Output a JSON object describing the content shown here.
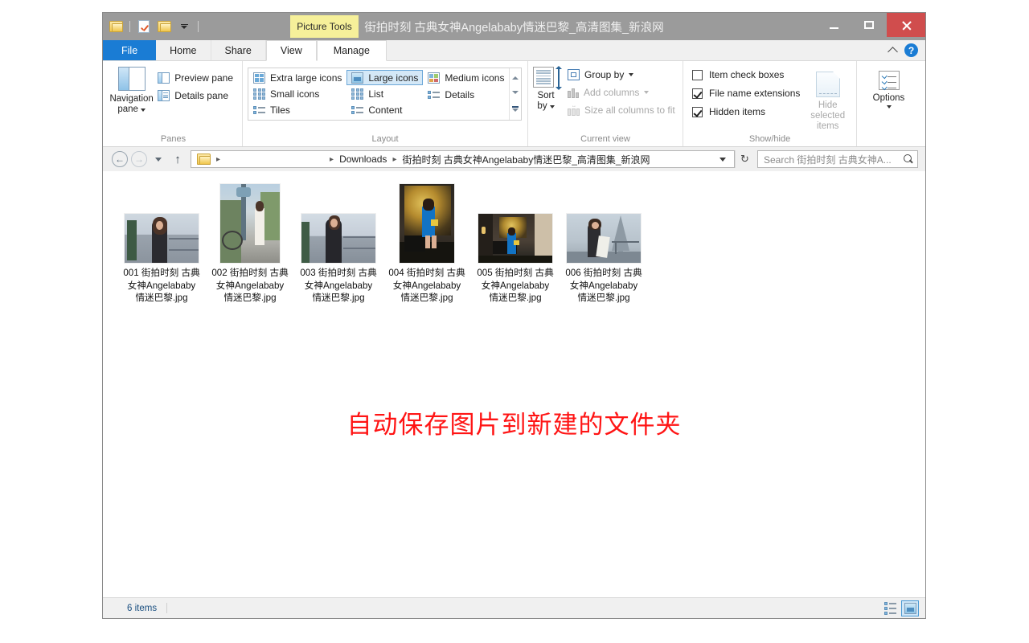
{
  "window": {
    "title": "街拍时刻 古典女神Angelababy情迷巴黎_高清图集_新浪网",
    "contextual_tab_group": "Picture Tools",
    "minimize_label": "Minimize",
    "maximize_label": "Maximize",
    "close_label": "Close"
  },
  "quick_access": {
    "folder_icon": "folder-icon",
    "properties_icon": "properties-icon",
    "new_folder_icon": "new-folder-icon",
    "customize_icon": "customize-quick-access-icon"
  },
  "tabs": [
    {
      "label": "File",
      "state": "file"
    },
    {
      "label": "Home",
      "state": "normal"
    },
    {
      "label": "Share",
      "state": "normal"
    },
    {
      "label": "View",
      "state": "active"
    },
    {
      "label": "Manage",
      "state": "contextual"
    }
  ],
  "ribbon_right": {
    "collapse_icon": "chevron-up-icon",
    "help_icon": "help-icon",
    "help_glyph": "?"
  },
  "ribbon": {
    "groups": [
      {
        "label": "Panes",
        "big_button": {
          "line1": "Navigation",
          "line2": "pane",
          "icon": "navigation-pane-icon"
        },
        "items": [
          {
            "label": "Preview pane",
            "icon": "preview-pane-icon",
            "disabled": false
          },
          {
            "label": "Details pane",
            "icon": "details-pane-icon",
            "disabled": false
          }
        ]
      },
      {
        "label": "Layout",
        "gallery": [
          {
            "label": "Extra large icons",
            "icon": "extra-large-icons-icon",
            "selected": false
          },
          {
            "label": "Small icons",
            "icon": "small-icons-icon",
            "selected": false
          },
          {
            "label": "Tiles",
            "icon": "tiles-icon",
            "selected": false
          },
          {
            "label": "Large icons",
            "icon": "large-icons-icon",
            "selected": true
          },
          {
            "label": "List",
            "icon": "list-icon",
            "selected": false
          },
          {
            "label": "Content",
            "icon": "content-icon",
            "selected": false
          },
          {
            "label": "Medium icons",
            "icon": "medium-icons-icon",
            "selected": false
          },
          {
            "label": "Details",
            "icon": "details-icon",
            "selected": false
          }
        ]
      },
      {
        "label": "Current view",
        "big_button": {
          "line1": "Sort",
          "line2": "by",
          "icon": "sort-by-icon"
        },
        "items": [
          {
            "label": "Group by",
            "icon": "group-by-icon",
            "disabled": false,
            "dropdown": true
          },
          {
            "label": "Add columns",
            "icon": "add-columns-icon",
            "disabled": true,
            "dropdown": true
          },
          {
            "label": "Size all columns to fit",
            "icon": "size-columns-icon",
            "disabled": true,
            "dropdown": false
          }
        ]
      },
      {
        "label": "Show/hide",
        "checkboxes": [
          {
            "label": "Item check boxes",
            "checked": false
          },
          {
            "label": "File name extensions",
            "checked": true
          },
          {
            "label": "Hidden items",
            "checked": true
          }
        ],
        "hide_selected": {
          "line1": "Hide selected",
          "line2": "items",
          "icon": "hide-selected-items-icon",
          "disabled": true
        },
        "options": {
          "label": "Options",
          "icon": "options-icon"
        }
      }
    ]
  },
  "address_bar": {
    "back_glyph": "←",
    "forward_glyph": "→",
    "recent_icon": "recent-locations-icon",
    "up_glyph": "↑",
    "folder_icon": "folder-icon",
    "breadcrumbs": [
      "Downloads",
      "街拍时刻 古典女神Angelababy情迷巴黎_高清图集_新浪网"
    ],
    "separator": "▸",
    "dropdown_icon": "chevron-down-icon",
    "refresh_glyph": "↻",
    "search_placeholder": "Search 街拍时刻 古典女神A...",
    "search_icon": "search-icon"
  },
  "files": [
    {
      "name": "001 街拍时刻 古典女神Angelababy情迷巴黎.jpg",
      "thumb_w": 92,
      "thumb_h": 61,
      "style": "a"
    },
    {
      "name": "002 街拍时刻 古典女神Angelababy情迷巴黎.jpg",
      "thumb_w": 74,
      "thumb_h": 98,
      "style": "b"
    },
    {
      "name": "003 街拍时刻 古典女神Angelababy情迷巴黎.jpg",
      "thumb_w": 92,
      "thumb_h": 61,
      "style": "c"
    },
    {
      "name": "004 街拍时刻 古典女神Angelababy情迷巴黎.jpg",
      "thumb_w": 68,
      "thumb_h": 98,
      "style": "d"
    },
    {
      "name": "005 街拍时刻 古典女神Angelababy情迷巴黎.jpg",
      "thumb_w": 92,
      "thumb_h": 61,
      "style": "e"
    },
    {
      "name": "006 街拍时刻 古典女神Angelababy情迷巴黎.jpg",
      "thumb_w": 92,
      "thumb_h": 61,
      "style": "f"
    }
  ],
  "annotation": {
    "text": "自动保存图片到新建的文件夹",
    "color": "#ff1414"
  },
  "status_bar": {
    "item_count": "6 items",
    "details_view_icon": "details-view-icon",
    "large-icons_view_icon": "large-icons-view-icon"
  },
  "colors": {
    "titlebar": "#9b9b9b",
    "file_tab": "#1a7cd4",
    "contextual_tab": "#f6f09a",
    "close_button": "#d04d4d",
    "selection": "#d4e8f7",
    "annotation_red": "#ff1414"
  }
}
